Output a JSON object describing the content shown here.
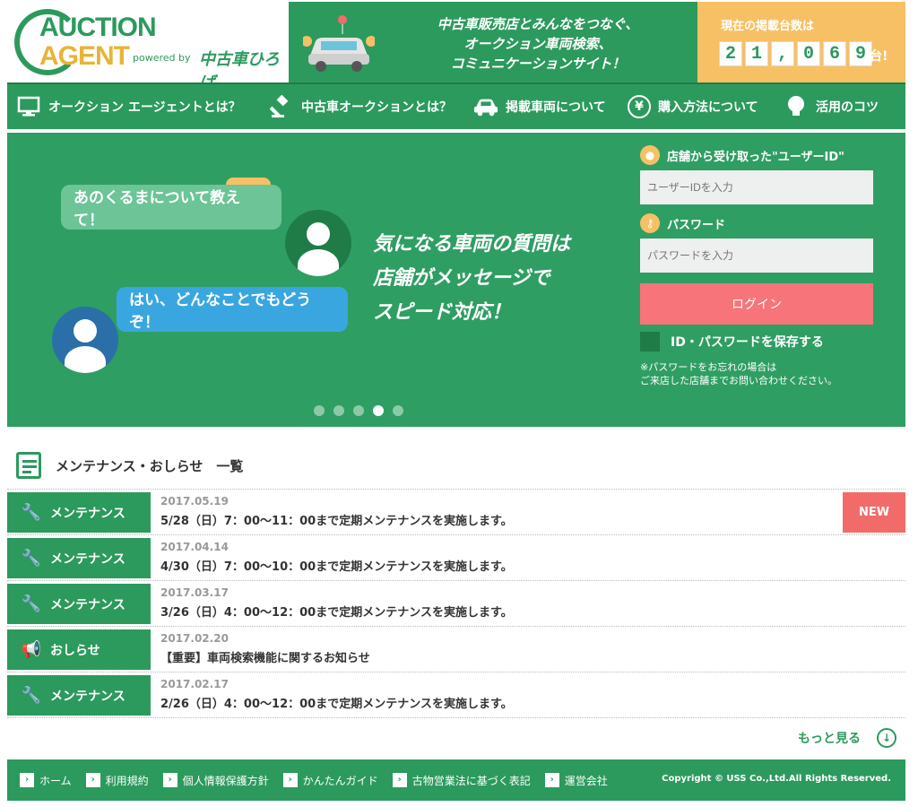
{
  "header": {
    "logo_line1": "AUCTION",
    "logo_line2": "AGENT",
    "logo_powered": "powered by",
    "logo_brand": "中古車ひろば",
    "tagline": [
      "中古車販売店とみんなをつなぐ、",
      "オークション車両検索、",
      "コミュニケーションサイト！"
    ],
    "counter_title": "現在の掲載台数は",
    "counter_digits": [
      "2",
      "1",
      ",",
      "0",
      "6",
      "9"
    ],
    "counter_unit": "台!"
  },
  "nav": [
    {
      "label": "オークション エージェントとは？",
      "icon": "monitor-icon"
    },
    {
      "label": "中古車オークションとは？",
      "icon": "gavel-icon"
    },
    {
      "label": "掲載車両について",
      "icon": "car-icon"
    },
    {
      "label": "購入方法について",
      "icon": "yen-icon"
    },
    {
      "label": "活用のコツ",
      "icon": "lightbulb-icon"
    }
  ],
  "banner": {
    "bubble_question": "あのくるまについて教えて！",
    "bubble_answer": "はい、どんなことでもどうぞ！",
    "copy": [
      "気になる車両の質問は",
      "店舗がメッセージで",
      "スピード対応！"
    ],
    "dots_total": 5,
    "dots_active": 4
  },
  "login": {
    "user_label": "店舗から受け取った\"ユーザーID\"",
    "user_placeholder": "ユーザーIDを入力",
    "password_label": "パスワード",
    "password_placeholder": "パスワードを入力",
    "button": "ログイン",
    "remember": "ID・パスワードを保存する",
    "note1": "※パスワードをお忘れの場合は",
    "note2": "ご来店した店舗までお問い合わせください。"
  },
  "news": {
    "title": "メンテナンス・おしらせ　一覧",
    "items": [
      {
        "category": "メンテナンス",
        "icon": "wrench-icon",
        "date": "2017.05.19",
        "text": "5/28（日）7：00～11：00まで定期メンテナンスを実施します。",
        "badge": "NEW"
      },
      {
        "category": "メンテナンス",
        "icon": "wrench-icon",
        "date": "2017.04.14",
        "text": "4/30（日）7：00～10：00まで定期メンテナンスを実施します。",
        "badge": ""
      },
      {
        "category": "メンテナンス",
        "icon": "wrench-icon",
        "date": "2017.03.17",
        "text": "3/26（日）4：00～12：00まで定期メンテナンスを実施します。",
        "badge": ""
      },
      {
        "category": "おしらせ",
        "icon": "megaphone-icon",
        "date": "2017.02.20",
        "text": "【重要】車両検索機能に関するお知らせ",
        "badge": ""
      },
      {
        "category": "メンテナンス",
        "icon": "wrench-icon",
        "date": "2017.02.17",
        "text": "2/26（日）4：00～12：00まで定期メンテナンスを実施します。",
        "badge": ""
      }
    ],
    "more": "もっと見る"
  },
  "footer": {
    "links": [
      "ホーム",
      "利用規約",
      "個人情報保護方針",
      "かんたんガイド",
      "古物営業法に基づく表記",
      "運営会社"
    ],
    "copyright": "Copyright © USS Co.,Ltd.All Rights Reserved."
  },
  "colors": {
    "brand_green": "#2c9a5d",
    "accent_yellow": "#f7c064",
    "login_red": "#f7747a",
    "new_badge": "#f26b6b"
  }
}
